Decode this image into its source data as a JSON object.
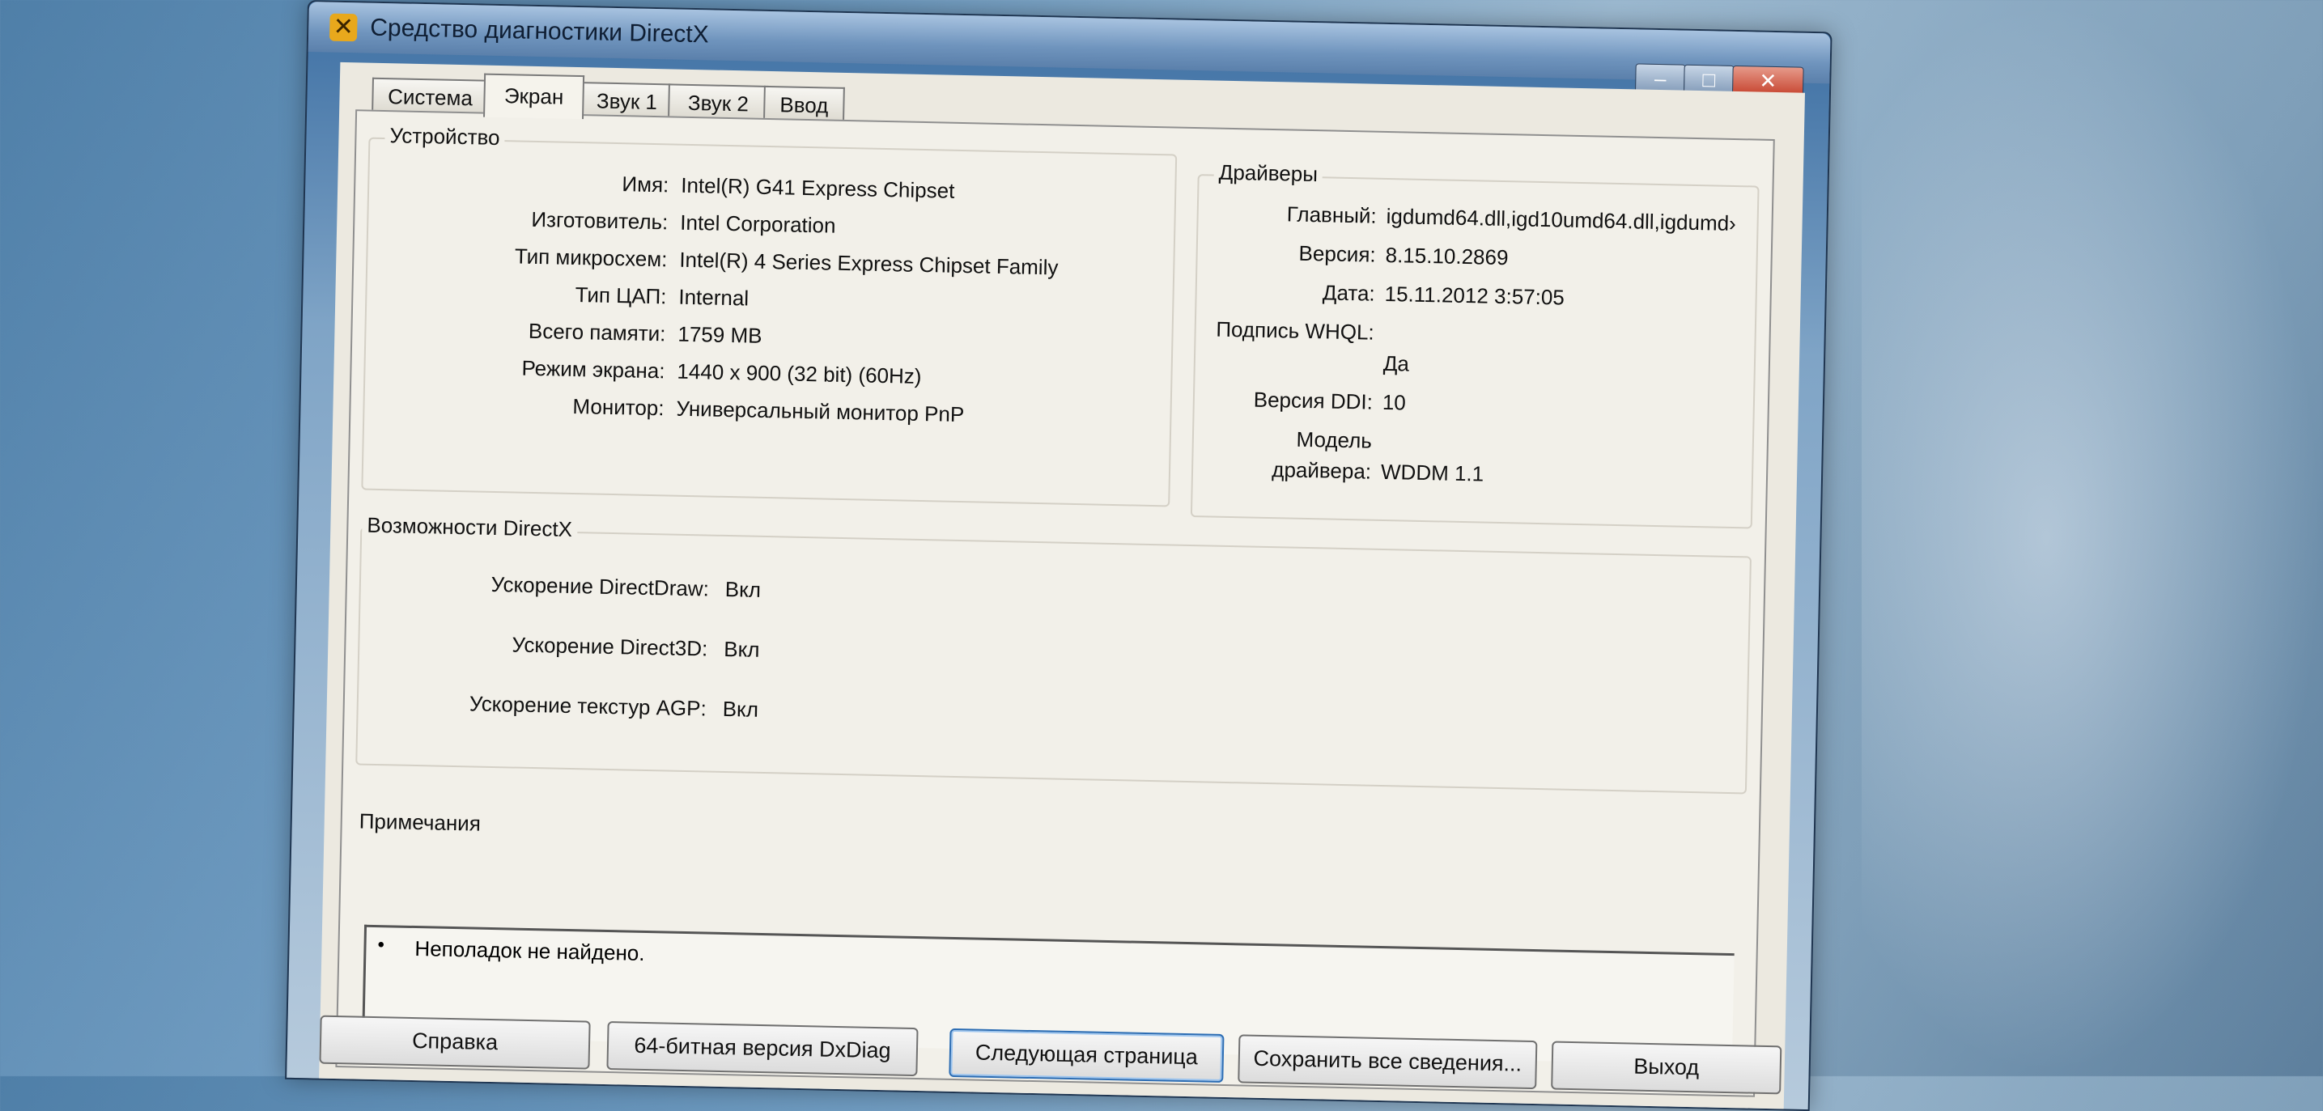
{
  "window": {
    "title": "Средство диагностики DirectX",
    "controls": {
      "minimize": "–",
      "maximize": "□",
      "close": "✕"
    }
  },
  "tabs": [
    {
      "label": "Система",
      "active": false
    },
    {
      "label": "Экран",
      "active": true
    },
    {
      "label": "Звук 1",
      "active": false
    },
    {
      "label": "Звук 2",
      "active": false
    },
    {
      "label": "Ввод",
      "active": false
    }
  ],
  "device": {
    "title": "Устройство",
    "rows": [
      {
        "label": "Имя:",
        "value": "Intel(R) G41 Express Chipset"
      },
      {
        "label": "Изготовитель:",
        "value": "Intel Corporation"
      },
      {
        "label": "Тип микросхем:",
        "value": "Intel(R) 4 Series Express Chipset Family"
      },
      {
        "label": "Тип ЦАП:",
        "value": "Internal"
      },
      {
        "label": "Всего памяти:",
        "value": "1759 MB"
      },
      {
        "label": "Режим экрана:",
        "value": "1440 x 900 (32 bit) (60Hz)"
      },
      {
        "label": "Монитор:",
        "value": "Универсальный монитор PnP"
      }
    ]
  },
  "drivers": {
    "title": "Драйверы",
    "main_label": "Главный:",
    "main_value": "igdumd64.dll,igd10umd64.dll,igdumd›",
    "version_label": "Версия:",
    "version_value": "8.15.10.2869",
    "date_label": "Дата:",
    "date_value": "15.11.2012 3:57:05",
    "whql_label": "Подпись WHQL:",
    "whql_value": "Да",
    "ddi_label": "Версия DDI:",
    "ddi_value": "10",
    "model_label_1": "Модель",
    "model_label_2": "драйвера:",
    "model_value": "WDDM 1.1"
  },
  "directx": {
    "title": "Возможности DirectX",
    "rows": [
      {
        "label": "Ускорение DirectDraw:",
        "value": "Вкл"
      },
      {
        "label": "Ускорение Direct3D:",
        "value": "Вкл"
      },
      {
        "label": "Ускорение текстур AGP:",
        "value": "Вкл"
      }
    ]
  },
  "notes": {
    "title": "Примечания",
    "items": [
      "Неполадок не найдено."
    ]
  },
  "buttons": {
    "help": "Справка",
    "dxdiag64": "64-битная версия DxDiag",
    "next_page": "Следующая страница",
    "save_all": "Сохранить все сведения...",
    "exit": "Выход"
  }
}
